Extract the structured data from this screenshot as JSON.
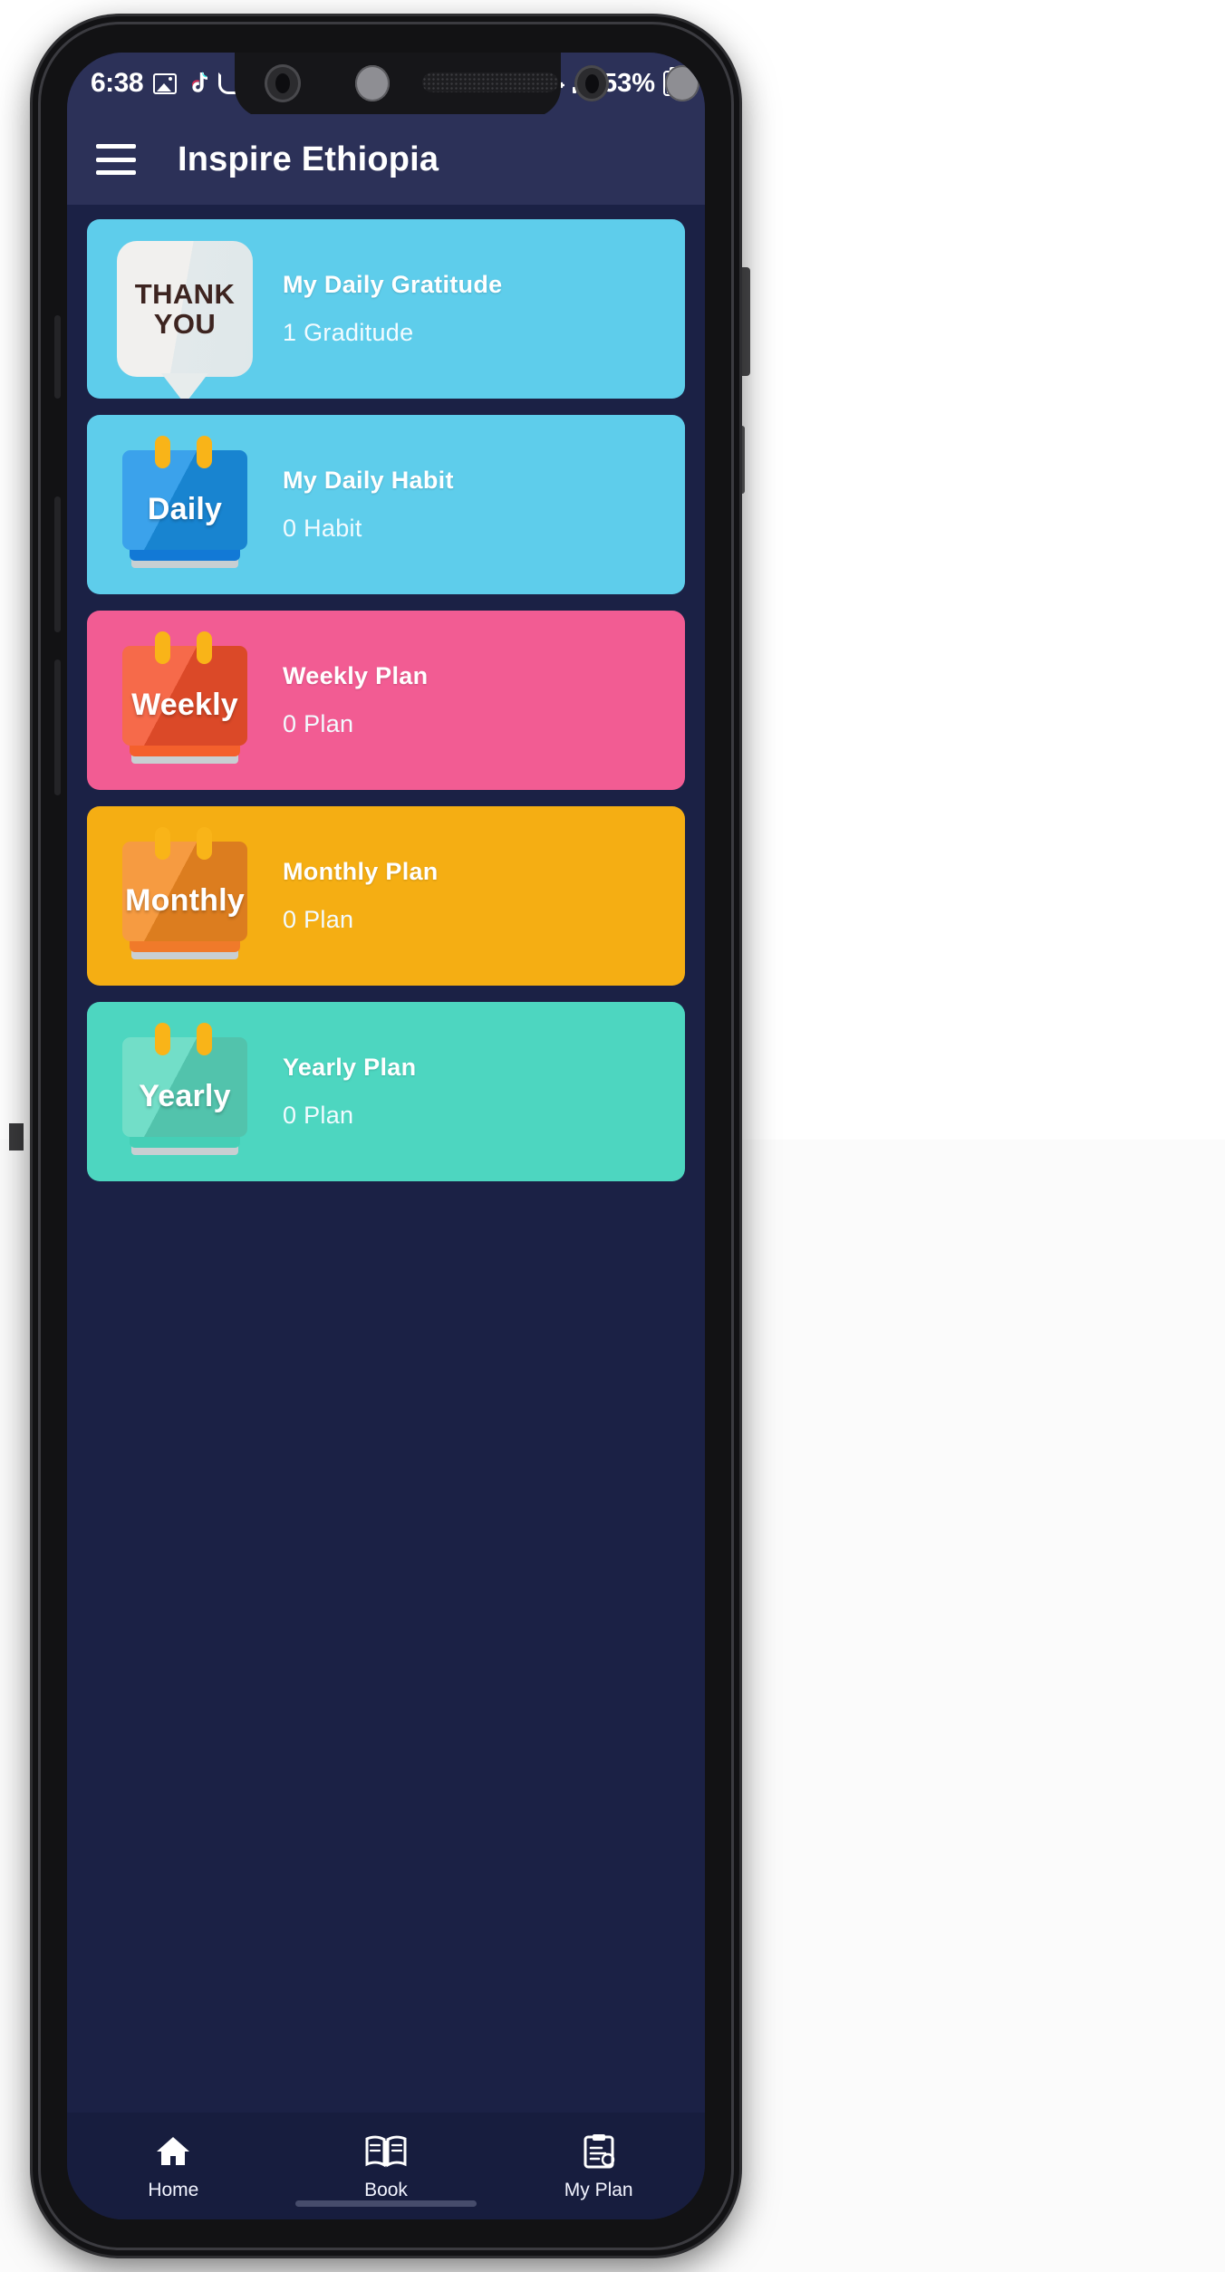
{
  "status_bar": {
    "time": "6:38",
    "left_icons": [
      "photo-icon",
      "tiktok-icon",
      "moon-icon"
    ],
    "battery_percent": "53%",
    "right_icons": [
      "wifi-icon",
      "signal-icon",
      "battery-icon"
    ]
  },
  "app_bar": {
    "menu_icon": "hamburger-menu-icon",
    "title": "Inspire Ethiopia"
  },
  "cards": [
    {
      "id": "gratitude",
      "title": "My Daily Gratitude",
      "subtitle": "1 Graditude",
      "bg_color": "#5ecdeb",
      "icon_type": "thank-you-bubble",
      "icon_line1": "THANK",
      "icon_line2": "YOU"
    },
    {
      "id": "habit",
      "title": "My Daily Habit",
      "subtitle": " 0 Habit",
      "bg_color": "#5ecdeb",
      "icon_type": "calendar",
      "icon_label": "Daily",
      "icon_color_top": "#1b93e8",
      "icon_color_bottom": "#1279d6"
    },
    {
      "id": "weekly",
      "title": "Weekly Plan",
      "subtitle": "0 Plan",
      "bg_color": "#f25c93",
      "icon_type": "calendar",
      "icon_label": "Weekly",
      "icon_color_top": "#f4512c",
      "icon_color_bottom": "#f4602c"
    },
    {
      "id": "monthly",
      "title": "Monthly Plan",
      "subtitle": "0 Plan",
      "bg_color": "#f5ae13",
      "icon_type": "calendar",
      "icon_label": "Monthly",
      "icon_color_top": "#f58b22",
      "icon_color_bottom": "#f07a2a"
    },
    {
      "id": "yearly",
      "title": "Yearly  Plan",
      "subtitle": "0 Plan",
      "bg_color": "#4dd6c0",
      "icon_type": "calendar",
      "icon_label": "Yearly",
      "icon_color_top": "#5bd9bf",
      "icon_color_bottom": "#45cfb6"
    }
  ],
  "bottom_nav": [
    {
      "label": "Home",
      "icon": "home-icon"
    },
    {
      "label": "Book",
      "icon": "book-icon"
    },
    {
      "label": "My Plan",
      "icon": "clipboard-icon"
    }
  ],
  "theme": {
    "screen_bg": "#1b2145",
    "appbar_bg": "#2c3158",
    "bottomnav_bg": "#171d3e",
    "text_on_card": "#ffffff"
  }
}
